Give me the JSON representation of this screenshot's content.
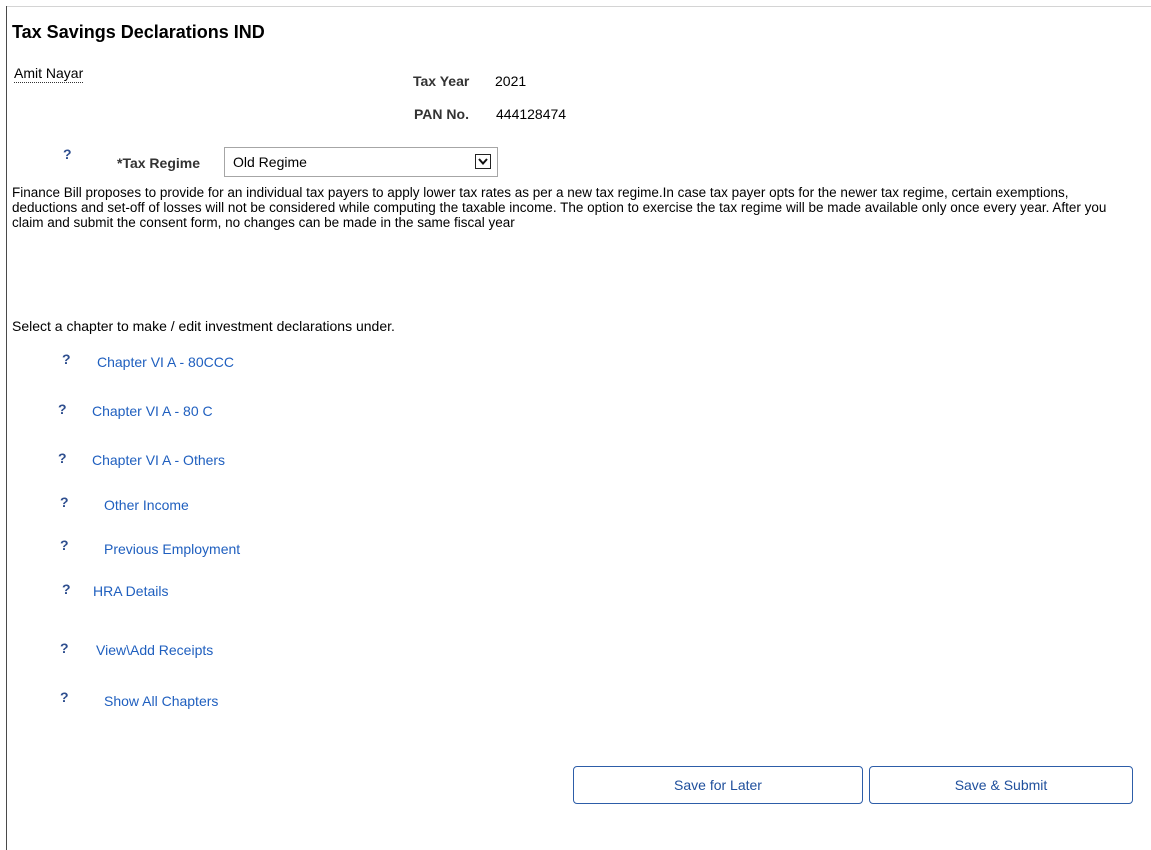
{
  "page": {
    "title": "Tax Savings Declarations IND",
    "employee_name": "Amit Nayar"
  },
  "info": {
    "tax_year_label": "Tax Year",
    "tax_year_value": "2021",
    "pan_label": "PAN No.",
    "pan_value": "444128474"
  },
  "regime": {
    "help": "?",
    "label": "*Tax Regime",
    "selected": "Old Regime",
    "note": "Finance Bill proposes to provide for an individual tax payers to apply lower tax rates as per a new tax regime.In case tax payer opts for the newer tax regime, certain exemptions, deductions and set-off of losses will not be considered while computing the taxable income. The option to exercise the tax regime will be made available only once every year. After you claim and submit the consent form, no changes can be made in the same fiscal year"
  },
  "chapters": {
    "prompt": "Select a chapter to make / edit investment declarations under.",
    "help": "?",
    "items": [
      {
        "label": "Chapter VI A - 80CCC"
      },
      {
        "label": "Chapter VI A - 80 C"
      },
      {
        "label": "Chapter VI A - Others"
      },
      {
        "label": "Other Income"
      },
      {
        "label": "Previous Employment"
      },
      {
        "label": "HRA Details"
      },
      {
        "label": "View\\Add Receipts"
      },
      {
        "label": "Show All Chapters"
      }
    ]
  },
  "actions": {
    "save_later": "Save for Later",
    "save_submit": "Save & Submit"
  },
  "icons": {
    "help": "question-mark-icon",
    "dropdown": "chevron-down-icon"
  }
}
